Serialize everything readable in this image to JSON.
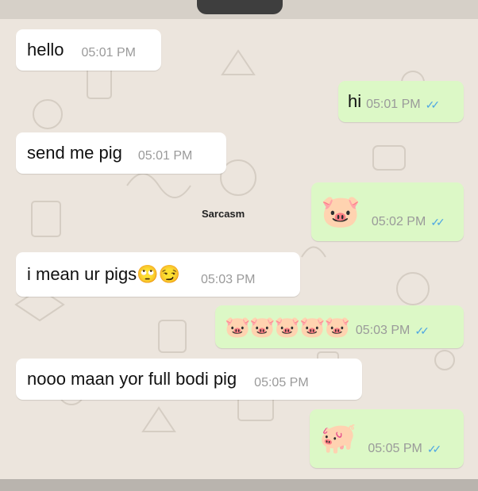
{
  "watermark": "Sarcasm",
  "read_ticks": "✓✓",
  "messages": [
    {
      "direction": "incoming",
      "text": "hello",
      "time": "05:01 PM"
    },
    {
      "direction": "outgoing",
      "text": "hi",
      "time": "05:01 PM",
      "read": true
    },
    {
      "direction": "incoming",
      "text": "send me pig",
      "time": "05:01 PM"
    },
    {
      "direction": "outgoing",
      "text": "🐷",
      "time": "05:02 PM",
      "read": true
    },
    {
      "direction": "incoming",
      "text": "i mean ur pigs🙄😏",
      "time": "05:03 PM"
    },
    {
      "direction": "outgoing",
      "text": "🐷🐷🐷🐷🐷",
      "time": "05:03 PM",
      "read": true
    },
    {
      "direction": "incoming",
      "text": "nooo maan yor full bodi pig",
      "time": "05:05 PM"
    },
    {
      "direction": "outgoing",
      "text": "🐖",
      "time": "05:05 PM",
      "read": true
    }
  ],
  "colors": {
    "incoming_bubble": "#ffffff",
    "outgoing_bubble": "#dcf8c6",
    "read_tick": "#4fa7e2",
    "wallpaper": "#ece5dd"
  }
}
